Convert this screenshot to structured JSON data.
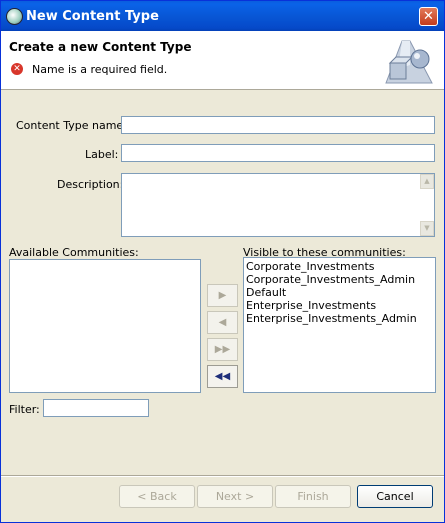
{
  "window": {
    "title": "New Content Type",
    "close_label": "✕"
  },
  "header": {
    "title": "Create a new Content Type",
    "error_message": "Name is a required field."
  },
  "form": {
    "name_label": "Content Type name:",
    "name_value": "",
    "label_label": "Label:",
    "label_value": "",
    "description_label": "Description:",
    "description_value": ""
  },
  "communities": {
    "available_label": "Available Communities:",
    "available_items": [],
    "visible_label": "Visible to these communities:",
    "visible_items": [
      "Corporate_Investments",
      "Corporate_Investments_Admin",
      "Default",
      "Enterprise_Investments",
      "Enterprise_Investments_Admin"
    ],
    "buttons": {
      "add": "▶",
      "remove": "◀",
      "add_all": "▶▶",
      "remove_all": "◀◀"
    }
  },
  "filter": {
    "label": "Filter:",
    "value": ""
  },
  "footer": {
    "back": "< Back",
    "next": "Next >",
    "finish": "Finish",
    "cancel": "Cancel"
  },
  "icons": [
    "app-icon",
    "close-icon",
    "error-icon",
    "wizard-banner-icon"
  ]
}
